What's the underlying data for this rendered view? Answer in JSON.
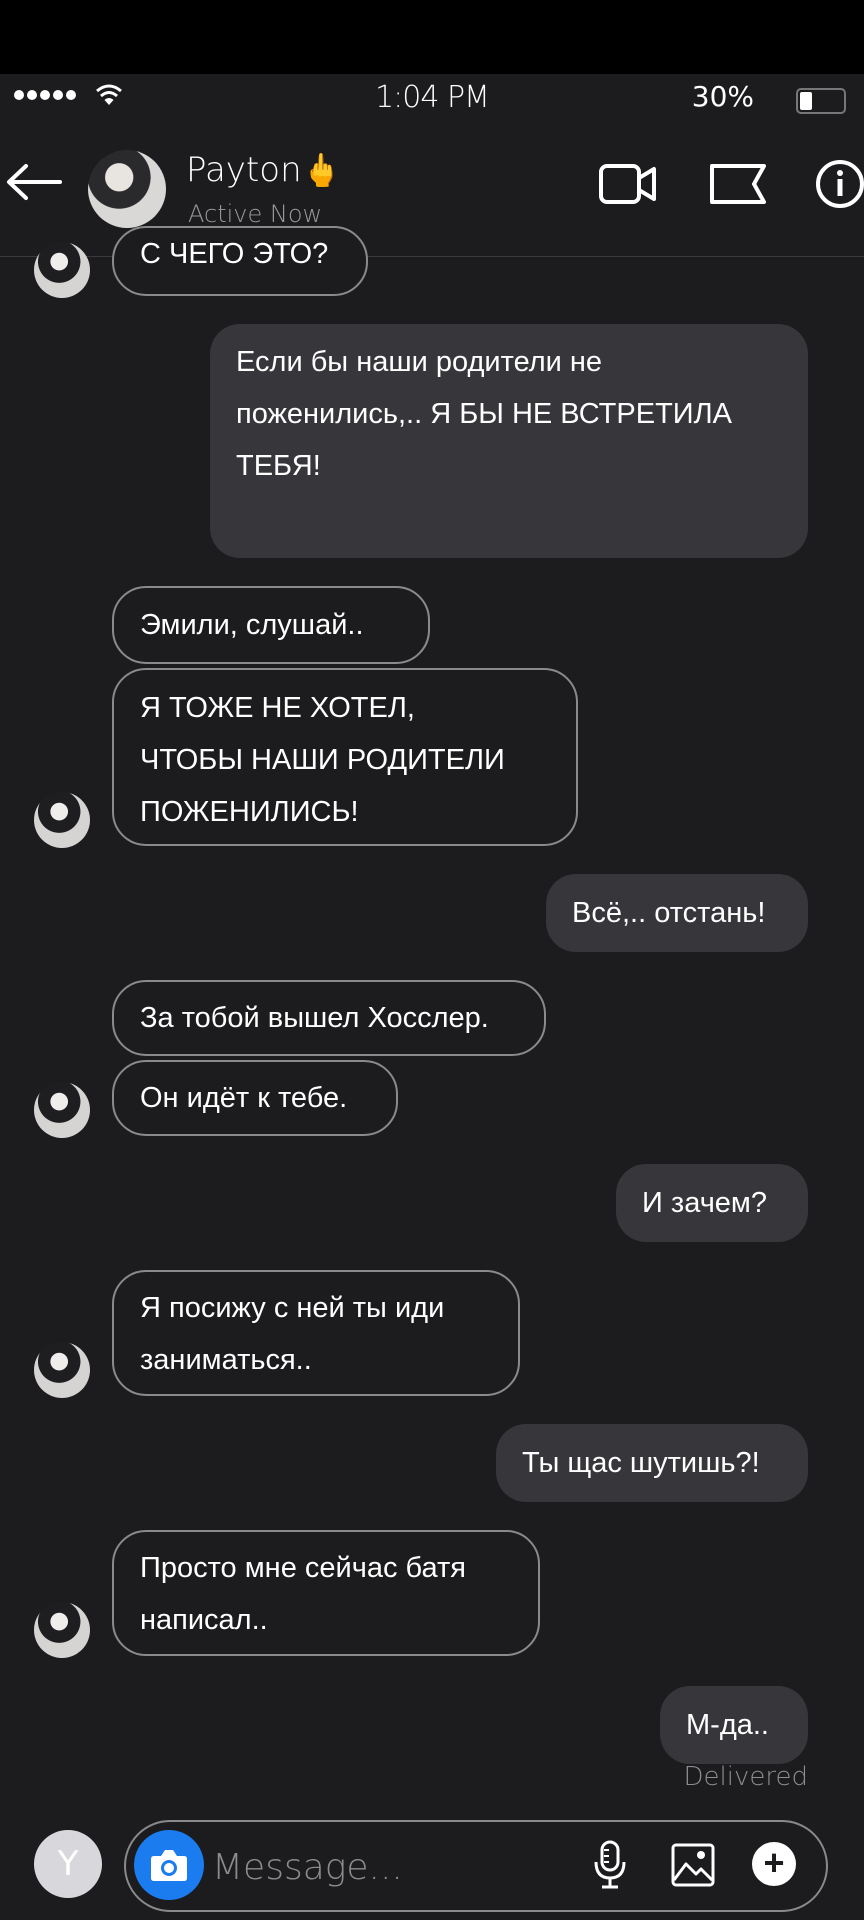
{
  "status_bar": {
    "time": "1:04 PM",
    "battery": "30%"
  },
  "header": {
    "contact_name": "Payton",
    "name_emoji": "🖕",
    "status": "Active Now"
  },
  "messages": [
    {
      "side": "in",
      "text": "С ЧЕГО ЭТО?"
    },
    {
      "side": "out",
      "text": "Если бы наши родители не\nпоженились,.. Я БЫ НЕ ВСТРЕТИЛА\nТЕБЯ!"
    },
    {
      "side": "in",
      "text": "Эмили, слушай.."
    },
    {
      "side": "in",
      "text": "Я ТОЖЕ НЕ ХОТЕЛ,\nЧТОБЫ НАШИ РОДИТЕЛИ\nПОЖЕНИЛИСЬ!"
    },
    {
      "side": "out",
      "text": "Всё,.. отстань!"
    },
    {
      "side": "in",
      "text": "За тобой вышел Хосслер."
    },
    {
      "side": "in",
      "text": "Он идёт к тебе."
    },
    {
      "side": "out",
      "text": "И зачем?"
    },
    {
      "side": "in",
      "text": "Я посижу с ней ты иди\nзаниматься.."
    },
    {
      "side": "out",
      "text": "Ты щас шутишь?!"
    },
    {
      "side": "in",
      "text": "Просто мне сейчас батя\nнаписал.."
    },
    {
      "side": "out",
      "text": "М-да.."
    }
  ],
  "delivered_label": "Delivered",
  "composer": {
    "avatar_letter": "Y",
    "placeholder": "Message..."
  },
  "colors": {
    "background": "#1c1b1d",
    "outgoing_bubble": "#37363a",
    "incoming_border": "#8a898c",
    "camera_button": "#1b7cf0"
  },
  "icons": [
    "back-arrow-icon",
    "video-call-icon",
    "flag-icon",
    "info-icon",
    "camera-icon",
    "microphone-icon",
    "image-icon",
    "plus-icon",
    "wifi-icon"
  ]
}
